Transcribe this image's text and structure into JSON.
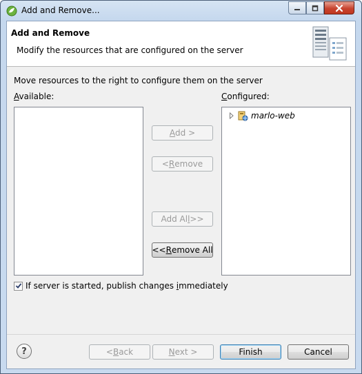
{
  "window": {
    "title": "Add and Remove..."
  },
  "header": {
    "title": "Add and Remove",
    "description": "Modify the resources that are configured on the server"
  },
  "instructions": "Move resources to the right to configure them on the server",
  "available": {
    "label_prefix": "",
    "label_mnemonic": "A",
    "label_rest": "vailable:",
    "items": []
  },
  "configured": {
    "label_prefix": "",
    "label_mnemonic": "C",
    "label_rest": "onfigured:",
    "items": [
      {
        "label": "marlo-web",
        "expanded": false
      }
    ]
  },
  "buttons": {
    "add": {
      "pre": "",
      "mn": "A",
      "post": "dd >",
      "enabled": false
    },
    "remove": {
      "pre": "< ",
      "mn": "R",
      "post": "emove",
      "enabled": false
    },
    "add_all": {
      "pre": "Add Al",
      "mn": "l",
      "post": " >>",
      "enabled": false
    },
    "remove_all": {
      "pre": "<< ",
      "mn": "R",
      "post": "emove All",
      "enabled": true
    }
  },
  "publish_option": {
    "pre": "If server is started, publish changes ",
    "mn": "i",
    "post": "mmediately",
    "checked": true
  },
  "footer": {
    "help_glyph": "?",
    "back": {
      "pre": "< ",
      "mn": "B",
      "post": "ack",
      "enabled": false
    },
    "next": {
      "pre": "",
      "mn": "N",
      "post": "ext >",
      "enabled": false
    },
    "finish": {
      "label": "Finish",
      "enabled": true
    },
    "cancel": {
      "label": "Cancel",
      "enabled": true
    }
  },
  "colors": {
    "close_button": "#c7432f",
    "titlebar": "#d6e4f3",
    "dialog_bg": "#f0f0f0"
  },
  "icons": [
    "app-icon",
    "minimize-icon",
    "maximize-icon",
    "close-icon",
    "server-icon",
    "expand-arrow-icon",
    "project-icon",
    "checkmark-icon",
    "help-icon"
  ]
}
